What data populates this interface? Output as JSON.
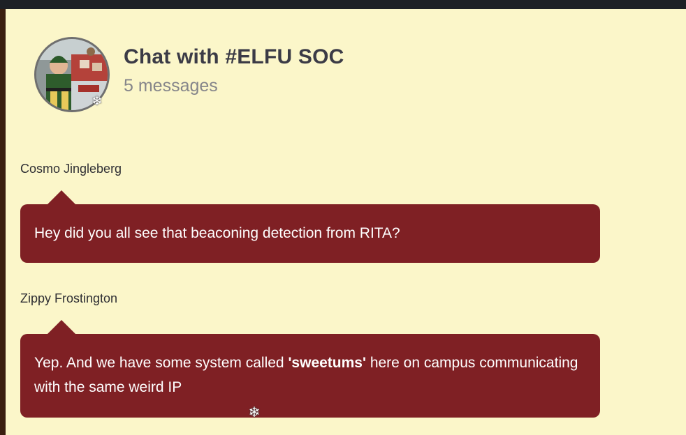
{
  "chat": {
    "title": "Chat with #ELFU SOC",
    "message_count": "5 messages",
    "avatar_icon": "elf-photo-avatar",
    "badge_icon": "snowflake-icon"
  },
  "messages": [
    {
      "sender": "Cosmo Jingleberg",
      "text": "Hey did you all see that beaconing detection from RITA?"
    },
    {
      "sender": "Zippy Frostington",
      "text_before": "Yep. And we have some system called ",
      "text_bold": "'sweetums'",
      "text_after": " here on campus communicating with the same weird IP"
    }
  ],
  "colors": {
    "background": "#fbf6c9",
    "bubble": "#7f2024",
    "title": "#3b3b46",
    "subtitle": "#85858a"
  }
}
